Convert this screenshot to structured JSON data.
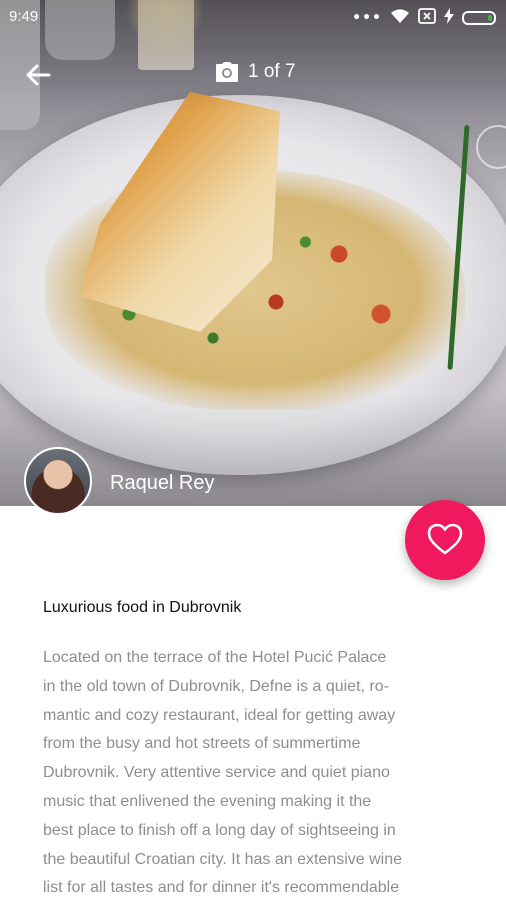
{
  "status_bar": {
    "time": "9:49",
    "more": "•••"
  },
  "header": {
    "photo_counter": "1 of 7"
  },
  "author": {
    "name": "Raquel Rey"
  },
  "review": {
    "title": "Luxurious food in Dubrovnik",
    "body": "Located on the terrace of the Hotel Pucić Palace\nin the old town of Dubrovnik, Defne is a quiet, ro-\nmantic and cozy restaurant, ideal for getting away\nfrom the busy and hot streets of summertime\nDubrovnik. Very attentive service and quiet piano\nmusic that enlivened the evening making it the\nbest place to finish off a long day of sightseeing in\nthe beautiful Croatian city. It has an extensive wine\nlist for all tastes and for dinner it's recommendable"
  },
  "colors": {
    "accent": "#f1195e",
    "body_text": "#8e8e8e",
    "title_text": "#111111"
  },
  "icons": {
    "back": "arrow-left-icon",
    "camera": "camera-icon",
    "favorite": "heart-outline-icon",
    "wifi": "wifi-icon",
    "sim": "sim-x-icon",
    "charging": "bolt-icon",
    "battery": "battery-icon"
  }
}
